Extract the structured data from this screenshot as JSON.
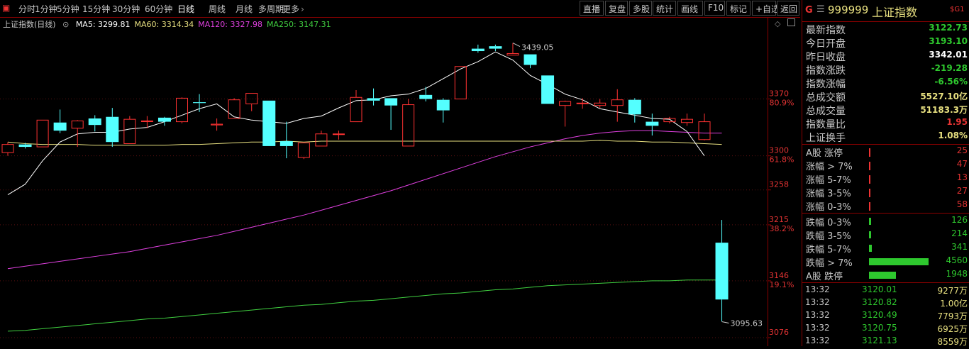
{
  "toolbar": {
    "periods": [
      "分时",
      "1分钟",
      "5分钟",
      "15分钟",
      "30分钟",
      "60分钟",
      "日线",
      "周线",
      "月线",
      "多周期",
      "更多"
    ],
    "active_period": "日线",
    "tools": [
      "直播",
      "复盘",
      "多股",
      "统计",
      "画线",
      "F10",
      "标记",
      "+自选",
      "返回"
    ]
  },
  "chart": {
    "title": "上证指数(日线)",
    "ma": [
      {
        "label": "MA5: 3299.81",
        "color": "#ffffff"
      },
      {
        "label": "MA60: 3314.34",
        "color": "#e8e080"
      },
      {
        "label": "MA120: 3327.98",
        "color": "#e040e0"
      },
      {
        "label": "MA250: 3147.31",
        "color": "#40d040"
      }
    ],
    "high_label": "3439.05",
    "low_label": "3095.63",
    "axis": [
      {
        "price": "3370",
        "pct": "80.9%"
      },
      {
        "price": "3300",
        "pct": "61.8%"
      },
      {
        "price": "3258",
        "pct": ""
      },
      {
        "price": "3215",
        "pct": "38.2%"
      },
      {
        "price": "3146",
        "pct": "19.1%"
      },
      {
        "price": "3076",
        "pct": ""
      }
    ]
  },
  "chart_data": {
    "type": "candlestick",
    "ylim": [
      3076,
      3450
    ],
    "candles": [
      {
        "o": 3304,
        "c": 3314,
        "h": 3317,
        "l": 3300
      },
      {
        "o": 3314,
        "c": 3311,
        "h": 3316,
        "l": 3309
      },
      {
        "o": 3311,
        "c": 3344,
        "h": 3344,
        "l": 3311
      },
      {
        "o": 3341,
        "c": 3331,
        "h": 3357,
        "l": 3328
      },
      {
        "o": 3334,
        "c": 3343,
        "h": 3344,
        "l": 3311
      },
      {
        "o": 3346,
        "c": 3338,
        "h": 3350,
        "l": 3330
      },
      {
        "o": 3348,
        "c": 3317,
        "h": 3359,
        "l": 3311
      },
      {
        "o": 3315,
        "c": 3345,
        "h": 3349,
        "l": 3315
      },
      {
        "o": 3343,
        "c": 3343,
        "h": 3349,
        "l": 3334
      },
      {
        "o": 3347,
        "c": 3342,
        "h": 3348,
        "l": 3337
      },
      {
        "o": 3342,
        "c": 3371,
        "h": 3372,
        "l": 3340
      },
      {
        "o": 3366,
        "c": 3365,
        "h": 3376,
        "l": 3354
      },
      {
        "o": 3338,
        "c": 3339,
        "h": 3346,
        "l": 3331
      },
      {
        "o": 3346,
        "c": 3369,
        "h": 3371,
        "l": 3346
      },
      {
        "o": 3364,
        "c": 3377,
        "h": 3377,
        "l": 3355
      },
      {
        "o": 3368,
        "c": 3312,
        "h": 3368,
        "l": 3312
      },
      {
        "o": 3318,
        "c": 3312,
        "h": 3342,
        "l": 3297
      },
      {
        "o": 3298,
        "c": 3316,
        "h": 3316,
        "l": 3296
      },
      {
        "o": 3312,
        "c": 3327,
        "h": 3331,
        "l": 3312
      },
      {
        "o": 3327,
        "c": 3327,
        "h": 3331,
        "l": 3320
      },
      {
        "o": 3342,
        "c": 3372,
        "h": 3381,
        "l": 3342
      },
      {
        "o": 3371,
        "c": 3368,
        "h": 3383,
        "l": 3362
      },
      {
        "o": 3371,
        "c": 3362,
        "h": 3371,
        "l": 3332
      },
      {
        "o": 3312,
        "c": 3363,
        "h": 3370,
        "l": 3312
      },
      {
        "o": 3375,
        "c": 3370,
        "h": 3385,
        "l": 3367
      },
      {
        "o": 3369,
        "c": 3356,
        "h": 3371,
        "l": 3341
      },
      {
        "o": 3370,
        "c": 3410,
        "h": 3410,
        "l": 3370
      },
      {
        "o": 3432,
        "c": 3429,
        "h": 3437,
        "l": 3427
      },
      {
        "o": 3435,
        "c": 3432,
        "h": 3437,
        "l": 3429
      },
      {
        "o": 3424,
        "c": 3426,
        "h": 3439,
        "l": 3424
      },
      {
        "o": 3425,
        "c": 3412,
        "h": 3425,
        "l": 3408
      },
      {
        "o": 3399,
        "c": 3364,
        "h": 3399,
        "l": 3364
      },
      {
        "o": 3362,
        "c": 3367,
        "h": 3368,
        "l": 3336
      },
      {
        "o": 3365,
        "c": 3365,
        "h": 3371,
        "l": 3358
      },
      {
        "o": 3362,
        "c": 3365,
        "h": 3370,
        "l": 3359
      },
      {
        "o": 3362,
        "c": 3369,
        "h": 3382,
        "l": 3342
      },
      {
        "o": 3369,
        "c": 3351,
        "h": 3371,
        "l": 3341
      },
      {
        "o": 3342,
        "c": 3337,
        "h": 3352,
        "l": 3325
      },
      {
        "o": 3342,
        "c": 3346,
        "h": 3348,
        "l": 3340
      },
      {
        "o": 3341,
        "c": 3345,
        "h": 3352,
        "l": 3337
      },
      {
        "o": 3320,
        "c": 3342,
        "h": 3352,
        "l": 3319
      },
      {
        "o": 3193,
        "c": 3123,
        "h": 3221,
        "l": 3096
      }
    ],
    "ma5": [
      3252,
      3265,
      3294,
      3317,
      3327,
      3329,
      3329,
      3333,
      3335,
      3342,
      3350,
      3358,
      3364,
      3348,
      3344,
      3342,
      3340,
      3346,
      3349,
      3359,
      3368,
      3369,
      3374,
      3376,
      3383,
      3395,
      3407,
      3416,
      3428,
      3418,
      3399,
      3388,
      3376,
      3369,
      3358,
      3354,
      3350,
      3346,
      3345,
      3330,
      3300
    ],
    "ma60": [
      3317,
      3315,
      3314,
      3314,
      3314,
      3313,
      3313,
      3313,
      3313,
      3313,
      3314,
      3314,
      3315,
      3316,
      3317,
      3317,
      3318,
      3317,
      3318,
      3318,
      3318,
      3318,
      3318,
      3318,
      3318,
      3318,
      3318,
      3318,
      3318,
      3318,
      3318,
      3318,
      3318,
      3318,
      3319,
      3318,
      3318,
      3317,
      3317,
      3316,
      3315,
      3314
    ],
    "ma120": [
      3161,
      3164,
      3167,
      3170,
      3173,
      3176,
      3179,
      3182,
      3186,
      3190,
      3194,
      3198,
      3202,
      3207,
      3212,
      3217,
      3222,
      3227,
      3233,
      3239,
      3245,
      3251,
      3257,
      3264,
      3271,
      3278,
      3285,
      3292,
      3299,
      3305,
      3311,
      3316,
      3321,
      3325,
      3328,
      3330,
      3331,
      3331,
      3330,
      3329,
      3328,
      3328
    ],
    "ma250": [
      3084,
      3085,
      3087,
      3089,
      3091,
      3093,
      3095,
      3097,
      3099,
      3100,
      3102,
      3104,
      3106,
      3108,
      3110,
      3112,
      3114,
      3116,
      3117,
      3119,
      3121,
      3122,
      3124,
      3126,
      3128,
      3130,
      3131,
      3133,
      3135,
      3136,
      3138,
      3140,
      3141,
      3142,
      3143,
      3144,
      3145,
      3146,
      3146,
      3147,
      3147,
      3147
    ]
  },
  "panel": {
    "code": "999999",
    "name": "上证指数",
    "stats": [
      {
        "label": "最新指数",
        "value": "3122.73",
        "color": "#2ec82e"
      },
      {
        "label": "今日开盘",
        "value": "3193.10",
        "color": "#2ec82e"
      },
      {
        "label": "昨日收盘",
        "value": "3342.01",
        "color": "#ffffff"
      },
      {
        "label": "指数涨跌",
        "value": "-219.28",
        "color": "#2ec82e"
      },
      {
        "label": "指数涨幅",
        "value": "-6.56%",
        "color": "#2ec82e"
      },
      {
        "label": "总成交额",
        "value": "5527.10亿",
        "color": "#e8e080"
      },
      {
        "label": "总成交量",
        "value": "51183.3万",
        "color": "#e8e080"
      },
      {
        "label": "指数量比",
        "value": "1.95",
        "color": "#e33333"
      },
      {
        "label": "上证换手",
        "value": "1.08%",
        "color": "#e8e080"
      }
    ],
    "up": [
      {
        "label": "A股 涨停",
        "value": "25"
      },
      {
        "label": "涨幅 > 7%",
        "value": "47"
      },
      {
        "label": "涨幅 5-7%",
        "value": "13"
      },
      {
        "label": "涨幅 3-5%",
        "value": "27"
      },
      {
        "label": "涨幅 0-3%",
        "value": "58"
      }
    ],
    "down": [
      {
        "label": "跌幅 0-3%",
        "value": "126",
        "bar": 0.02
      },
      {
        "label": "跌幅 3-5%",
        "value": "214",
        "bar": 0.03
      },
      {
        "label": "跌幅 5-7%",
        "value": "341",
        "bar": 0.05
      },
      {
        "label": "跌幅 > 7%",
        "value": "4560",
        "bar": 1.0
      },
      {
        "label": "A股 跌停",
        "value": "1948",
        "bar": 0.45
      }
    ],
    "trades": [
      {
        "time": "13:32",
        "price": "3120.01",
        "vol": "9277万"
      },
      {
        "time": "13:32",
        "price": "3120.82",
        "vol": "1.00亿"
      },
      {
        "time": "13:32",
        "price": "3120.49",
        "vol": "7793万"
      },
      {
        "time": "13:32",
        "price": "3120.75",
        "vol": "6925万"
      },
      {
        "time": "13:32",
        "price": "3121.13",
        "vol": "8559万"
      }
    ]
  }
}
